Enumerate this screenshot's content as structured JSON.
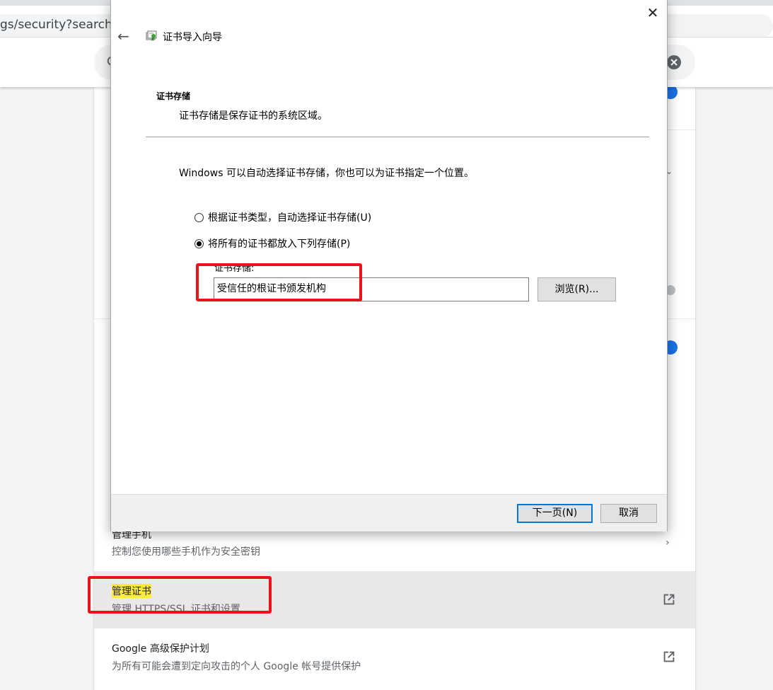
{
  "browser": {
    "url_fragment": "gs/security?search="
  },
  "settings": {
    "rows": [
      {
        "title": "管理手机",
        "subtitle": "控制您使用哪些手机作为安全密钥"
      },
      {
        "title": "管理证书",
        "subtitle": "管理 HTTPS/SSL 证书和设置"
      },
      {
        "title": "Google 高级保护计划",
        "subtitle": "为所有可能会遭到定向攻击的个人 Google 帐号提供保护"
      }
    ],
    "colors": {
      "toggle_on": "#1a73e8",
      "toggle_off": "#bdc1c6",
      "highlight": "#ffeb3b"
    }
  },
  "dialog": {
    "title": "证书导入向导",
    "section_title": "证书存储",
    "section_desc": "证书存储是保存证书的系统区域。",
    "intro": "Windows 可以自动选择证书存储，你也可以为证书指定一个位置。",
    "radio_auto": "根据证书类型，自动选择证书存储(U)",
    "radio_manual": "将所有的证书都放入下列存储(P)",
    "store_label": "证书存储:",
    "store_value": "受信任的根证书颁发机构",
    "browse_label": "浏览(R)...",
    "next_label": "下一页(N)",
    "cancel_label": "取消",
    "close_glyph": "✕",
    "back_glyph": "←"
  },
  "annotation_color": "#e8141c"
}
